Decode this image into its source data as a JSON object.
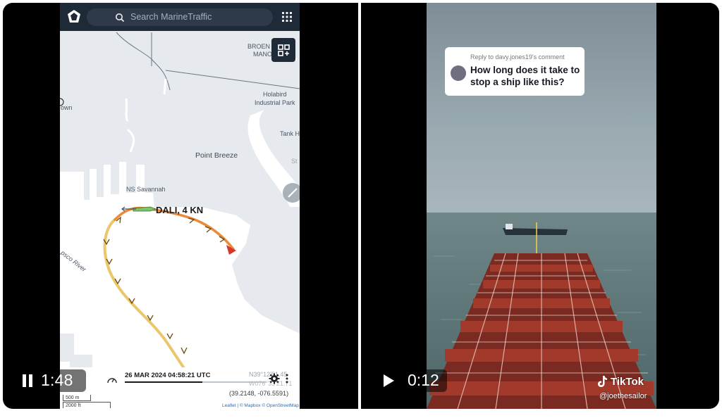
{
  "left_video": {
    "app": {
      "search_placeholder": "Search MarineTraffic",
      "logo_icon": "marinetraffic-logo-icon",
      "menu_icon": "grid-menu-icon",
      "layers_icon": "layers-icon"
    },
    "map": {
      "place_labels": {
        "broening": "BROEN",
        "manor": "MANO",
        "holabird": "Holabird",
        "industrial_park": "Industrial Park",
        "tank": "Tank H",
        "point_breeze": "Point Breeze",
        "ns_savannah": "NS Savannah",
        "town": "own",
        "river": "psco River",
        "st": "St"
      },
      "vessel_label": "DALI, 4 KN",
      "scale": [
        "500 m",
        "2000 ft"
      ],
      "attribution": "Leaflet | © Mapbox © OpenStreetMap"
    },
    "playback_bar": {
      "timestamp": "26 MAR 2024 04:58:21 UTC",
      "lat_faded": "N39°12'51.45",
      "lon_faded": "W076°33'21.71",
      "coords": "(39.2148, -076.5591)",
      "progress_fraction": 0.55,
      "speed_icon": "speedometer-icon",
      "settings_icon": "gear-icon",
      "more_icon": "kebab-menu-icon"
    },
    "player": {
      "control_icon": "pause-icon",
      "elapsed": "1:48"
    }
  },
  "right_video": {
    "comment": {
      "reply_to": "Reply to davy.jones19's comment",
      "question": "How long does it take to stop a ship like this?"
    },
    "watermark": {
      "brand": "TikTok",
      "handle": "@joethesailor",
      "logo_icon": "tiktok-note-icon"
    },
    "player": {
      "control_icon": "play-icon",
      "elapsed": "0:12"
    }
  },
  "colors": {
    "video_background": "#000000",
    "app_header": "#1f2a38",
    "map_land": "#e6e9ed",
    "map_water": "#ffffff",
    "track_orange": "#e98b3a",
    "track_yellow": "#e9c76a",
    "vessel_green": "#7cc46a",
    "container_red": "#8b2b22",
    "sky": "#8fa1a9"
  }
}
